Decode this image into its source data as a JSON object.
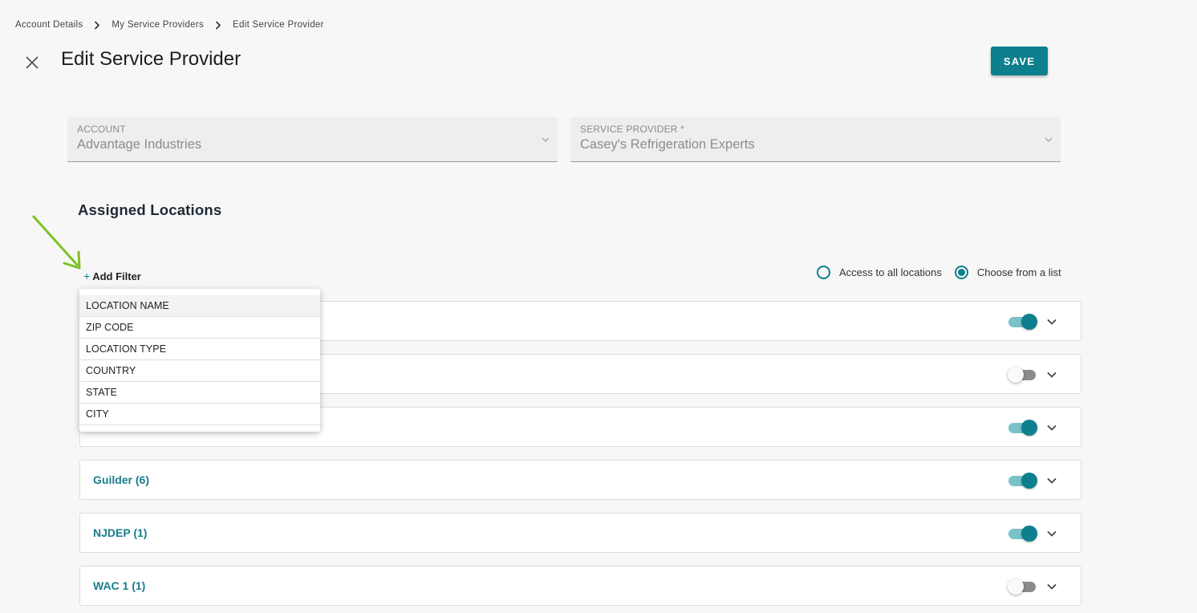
{
  "breadcrumb": [
    "Account Details",
    "My Service Providers",
    "Edit Service Provider"
  ],
  "header": {
    "title": "Edit Service Provider",
    "save_label": "SAVE"
  },
  "account": {
    "label": "ACCOUNT",
    "value": "Advantage Industries"
  },
  "service_provider": {
    "label": "SERVICE PROVIDER *",
    "value": "Casey's Refrigeration Experts"
  },
  "assigned_locations": {
    "heading": "Assigned Locations",
    "add_filter_label": "Add Filter"
  },
  "access_options": {
    "all_label": "Access to all locations",
    "list_label": "Choose from a list",
    "selected": "list"
  },
  "filter_options": [
    "LOCATION NAME",
    "ZIP CODE",
    "LOCATION TYPE",
    "COUNTRY",
    "STATE",
    "CITY"
  ],
  "locations": [
    {
      "name": "",
      "enabled": true
    },
    {
      "name": "",
      "enabled": false
    },
    {
      "name": "",
      "enabled": true
    },
    {
      "name": "Guilder (6)",
      "enabled": true
    },
    {
      "name": "NJDEP (1)",
      "enabled": true
    },
    {
      "name": "WAC 1 (1)",
      "enabled": false
    }
  ],
  "colors": {
    "accent": "#0e7f8c",
    "arrow": "#7cc225"
  },
  "icons": [
    "close-icon",
    "chevron-right-icon",
    "chevron-down-icon",
    "plus-icon",
    "arrow-annotation-icon"
  ]
}
